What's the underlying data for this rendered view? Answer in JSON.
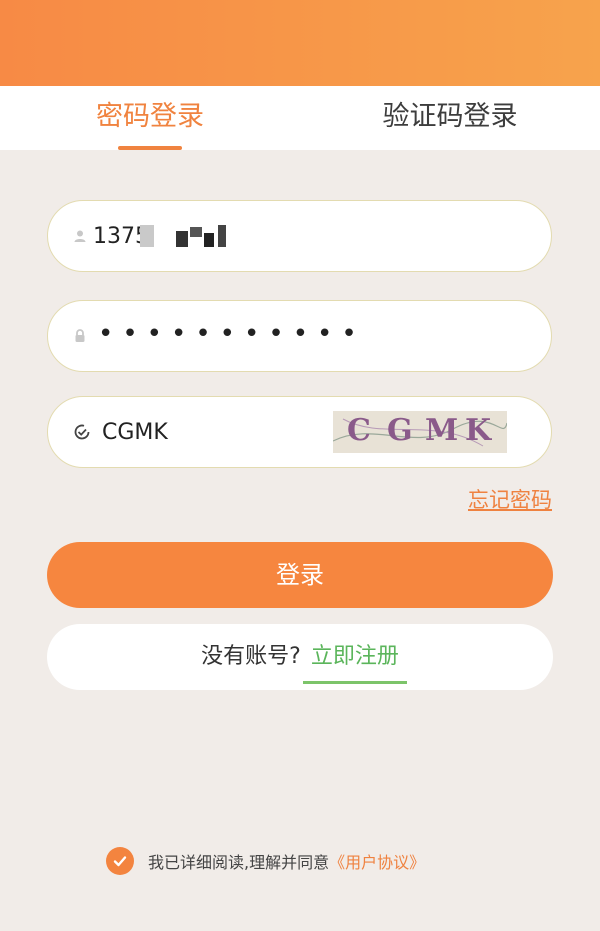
{
  "tabs": {
    "password_login": "密码登录",
    "code_login": "验证码登录"
  },
  "form": {
    "phone_value": "1375",
    "password_mask": "•••••••••••",
    "captcha_value": "CGMK",
    "captcha_image_text": "CGMK",
    "forgot_label": "忘记密码",
    "login_label": "登录"
  },
  "register": {
    "question": "没有账号?",
    "link": "立即注册"
  },
  "agreement": {
    "text": "我已详细阅读,理解并同意",
    "link": "《用户协议》"
  },
  "colors": {
    "accent": "#f6863f",
    "register_link": "#5bb55b"
  }
}
